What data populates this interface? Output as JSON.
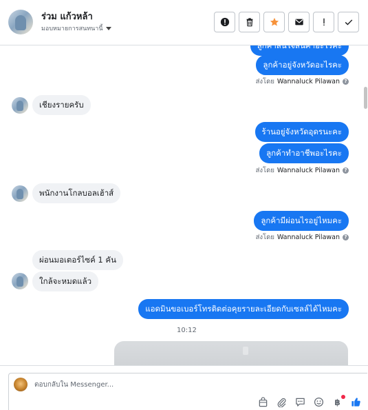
{
  "header": {
    "name": "ร่วม แก้วหล้า",
    "subtitle": "มอบหมายการสนทนานี้"
  },
  "toolbar": {
    "buttons": [
      "spam-icon",
      "trash-icon",
      "star-icon",
      "envelope-icon",
      "exclamation-icon",
      "check-icon"
    ],
    "star_color": "#f7923a"
  },
  "messages": {
    "m0": "ลูกค้าสนใจสินค้าอะไรคะ",
    "m1": "ลูกค้าอยู่จังหวัดอะไรคะ",
    "m2": "เชียงรายครับ",
    "m3": "ร้านอยู่จังหวัดอุดรนะคะ",
    "m4": "ลูกค้าทำอาชีพอะไรคะ",
    "m5": "พนักงานโกลบอลเฮ้าส์",
    "m6": "ลูกค้ามีผ่อนไรอยู่ไหมคะ",
    "m7": "ผ่อนมอเตอร์ไซค์ 1 คัน",
    "m8": "ใกล้จะหมดแล้ว",
    "m9": "แอดมินขอเบอร์โทรติดต่อคุยรายละเอียดกับเซลล์ได้ไหมคะ"
  },
  "sent_by": {
    "prefix": "ส่งโดย",
    "agent": "Wannaluck Pilawan"
  },
  "timestamp": "10:12",
  "composer": {
    "placeholder": "ตอบกลับใน Messenger...",
    "currency_symbol": "฿"
  },
  "colors": {
    "bubble_out": "#1877f2",
    "bubble_in": "#f0f2f5",
    "like": "#1877f2"
  }
}
